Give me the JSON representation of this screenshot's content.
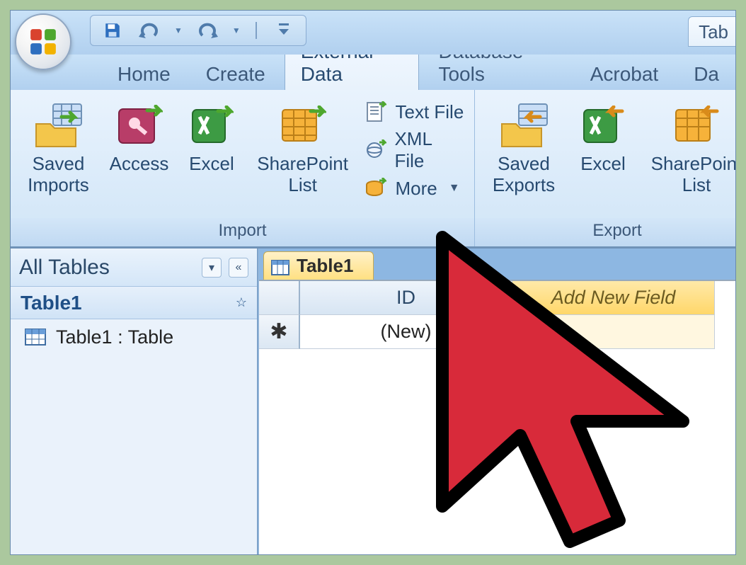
{
  "titlebar": {
    "topright_tab": "Tab"
  },
  "ribbon_tabs": {
    "home": "Home",
    "create": "Create",
    "external_data": "External Data",
    "database_tools": "Database Tools",
    "acrobat": "Acrobat",
    "partial": "Da"
  },
  "ribbon": {
    "import": {
      "group_label": "Import",
      "saved_imports": "Saved\nImports",
      "access": "Access",
      "excel": "Excel",
      "sharepoint_list": "SharePoint\nList",
      "text_file": "Text File",
      "xml_file": "XML File",
      "more": "More"
    },
    "export": {
      "group_label": "Export",
      "saved_exports": "Saved\nExports",
      "excel": "Excel",
      "sharepoint_list": "SharePoint\nList"
    }
  },
  "nav": {
    "title": "All Tables",
    "group_title": "Table1",
    "item1": "Table1 : Table"
  },
  "datasheet": {
    "tab_label": "Table1",
    "col_id": "ID",
    "col_new": "Add New Field",
    "new_row_placeholder": "(New)"
  }
}
